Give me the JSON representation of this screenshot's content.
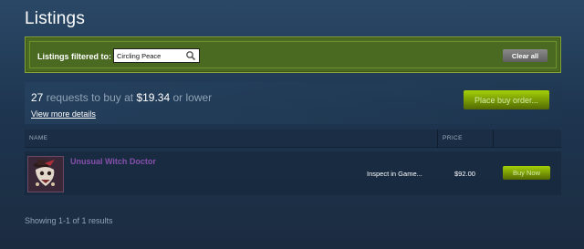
{
  "page": {
    "title": "Listings"
  },
  "filter": {
    "label": "Listings filtered to:",
    "search_value": "Circling Peace",
    "clear_label": "Clear all"
  },
  "buy_orders": {
    "count": "27",
    "text_mid": "requests to buy at",
    "price": "$19.34",
    "text_end": "or lower",
    "details_link": "View more details",
    "place_order_label": "Place buy order..."
  },
  "table": {
    "columns": {
      "name": "NAME",
      "price": "PRICE"
    },
    "rows": [
      {
        "item_name": "Unusual Witch Doctor",
        "inspect_label": "Inspect in Game...",
        "price": "$92.00",
        "buy_label": "Buy Now"
      }
    ]
  },
  "footer": {
    "results_text": "Showing 1-1 of 1 results"
  },
  "colors": {
    "unusual_quality": "#8650ac",
    "green_button": "#a4d007",
    "filter_bar": "#4c6b22"
  }
}
